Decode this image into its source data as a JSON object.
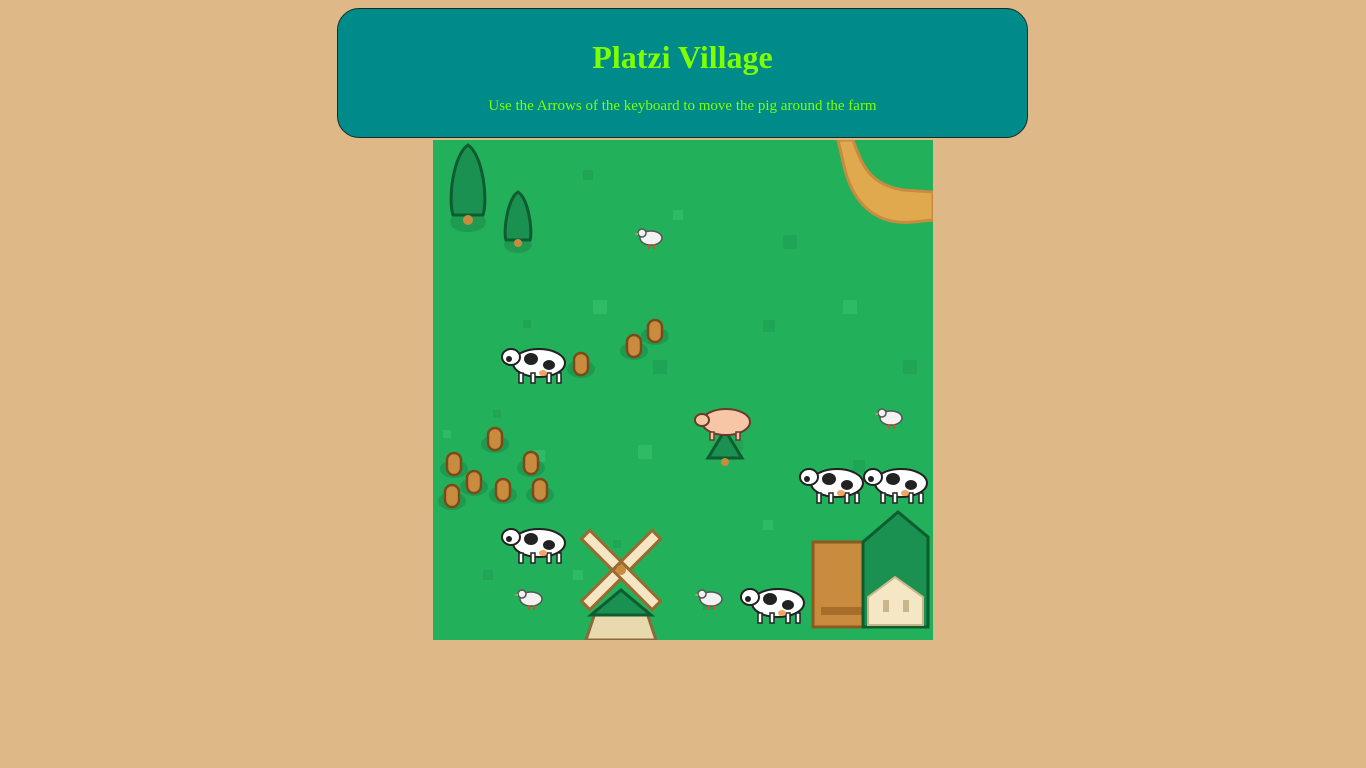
{
  "header": {
    "title": "Platzi Village",
    "instructions": "Use the Arrows of the keyboard to move the pig around the farm"
  },
  "colors": {
    "page_background": "#deb887",
    "header_background": "#008b8b",
    "header_text": "#7fff00",
    "grass": "#22b05b",
    "path": "#e0a94e"
  },
  "canvas": {
    "background_icon": "farm-tile-map",
    "sprites": [
      {
        "type": "tree",
        "icon": "tall-tree-icon"
      },
      {
        "type": "tree",
        "icon": "small-tree-icon"
      },
      {
        "type": "chicken",
        "icon": "chicken-icon"
      },
      {
        "type": "cow",
        "icon": "cow-icon"
      },
      {
        "type": "pig",
        "icon": "pig-icon"
      },
      {
        "type": "windmill",
        "icon": "windmill-icon"
      },
      {
        "type": "barn",
        "icon": "barn-icon"
      },
      {
        "type": "stump",
        "icon": "stump-icon"
      }
    ]
  }
}
